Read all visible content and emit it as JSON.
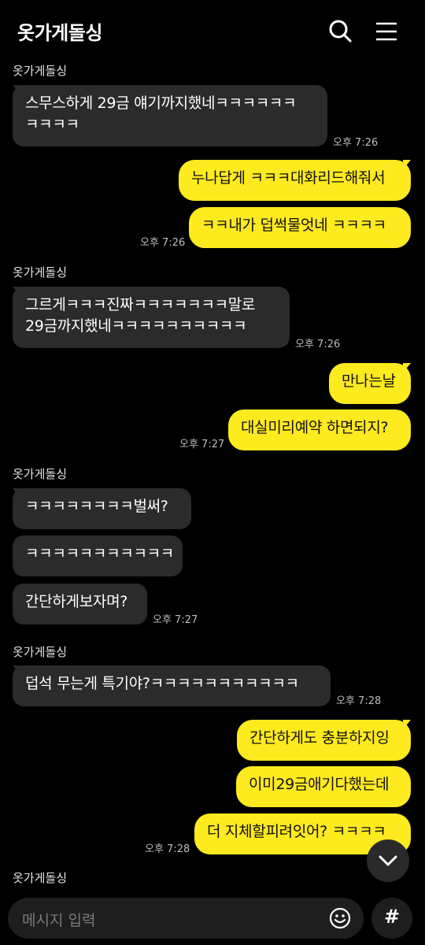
{
  "header": {
    "title": "옷가게돌싱",
    "search_icon": "search-icon",
    "menu_icon": "hamburger-menu-icon"
  },
  "messages": {
    "g1": {
      "sender": "옷가게돌싱",
      "m1_line1": "스무스하게 29금 얘기까지했네ㅋㅋㅋㅋㅋㅋ",
      "m1_line2": "ㅋㅋㅋㅋ",
      "time": "오후 7:26"
    },
    "o1": {
      "m1": "누나답게 ㅋㅋㅋ대화리드해줘서",
      "m2": "ㅋㅋ내가 덥썩물엇네 ㅋㅋㅋㅋ",
      "time": "오후 7:26"
    },
    "g2": {
      "sender": "옷가게돌싱",
      "m1_line1": "그르게ㅋㅋㅋ진짜ㅋㅋㅋㅋㅋㅋㅋ말로",
      "m1_line2": "29금까지했네ㅋㅋㅋㅋㅋㅋㅋㅋㅋㅋ",
      "time": "오후 7:26"
    },
    "o2": {
      "m1": "만나는날",
      "m2": "대실미리예약 하면되지?",
      "time": "오후 7:27"
    },
    "g3": {
      "sender": "옷가게돌싱",
      "m1": "ㅋㅋㅋㅋㅋㅋㅋㅋ벌써?",
      "m2": "ㅋㅋㅋㅋㅋㅋㅋㅋㅋㅋㅋ",
      "m3": "간단하게보자며?",
      "time": "오후 7:27"
    },
    "g4": {
      "sender": "옷가게돌싱",
      "m1": "덥석 무는게 특기야?ㅋㅋㅋㅋㅋㅋㅋㅋㅋㅋㅋ",
      "time": "오후 7:28"
    },
    "o3": {
      "m1": "간단하게도 충분하지잉",
      "m2": "이미29금애기다했는데",
      "m3": "더 지체할피려잇어? ㅋㅋㅋㅋ",
      "time": "오후 7:28"
    },
    "g5": {
      "sender": "옷가게돌싱"
    }
  },
  "composer": {
    "placeholder": "메시지 입력",
    "emoji_icon": "emoji-icon",
    "hash_label": "#"
  },
  "colors": {
    "outgoing_bubble": "#fdea1f",
    "incoming_bubble": "#2b2b2b",
    "background": "#000000"
  }
}
